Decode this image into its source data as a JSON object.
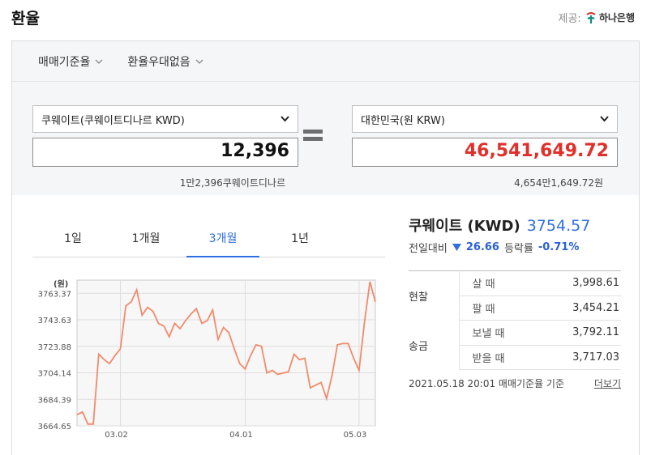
{
  "header": {
    "title": "환율",
    "provider_label": "제공:",
    "bank_name": "하나은행"
  },
  "options": [
    "매매기준율",
    "환율우대없음"
  ],
  "converter": {
    "from_currency": "쿠웨이트(쿠웨이트디나르 KWD)",
    "from_amount": "12,396",
    "from_words": "1만2,396쿠웨이트디나르",
    "to_currency": "대한민국(원 KRW)",
    "to_amount": "46,541,649.72",
    "to_words": "4,654만1,649.72원"
  },
  "tabs": [
    "1일",
    "1개월",
    "3개월",
    "1년"
  ],
  "active_tab": 2,
  "info": {
    "name": "쿠웨이트 (KWD)",
    "rate": "3754.57",
    "prev_label": "전일대비",
    "change": "26.66",
    "pct_label": "등락률",
    "pct": "-0.71%"
  },
  "rates_table": [
    {
      "category": "현찰",
      "label": "살 때",
      "value": "3,998.61"
    },
    {
      "category": "",
      "label": "팔 때",
      "value": "3,454.21"
    },
    {
      "category": "송금",
      "label": "보낼 때",
      "value": "3,792.11"
    },
    {
      "category": "",
      "label": "받을 때",
      "value": "3,717.03"
    }
  ],
  "footnote": {
    "text": "2021.05.18 20:01 매매기준율 기준",
    "more": "더보기"
  },
  "colors": {
    "accent_blue": "#2f6fe1",
    "amount_red": "#e0302b",
    "line": "#f28b6b"
  },
  "chart_data": {
    "type": "line",
    "ylabel": "(원)",
    "y_ticks": [
      "3763.37",
      "3743.63",
      "3723.88",
      "3704.14",
      "3684.39",
      "3664.65"
    ],
    "ylim": [
      3664.65,
      3773.2
    ],
    "x_ticks": [
      "03.02",
      "04.01",
      "05.03"
    ],
    "grid": true,
    "series": [
      {
        "values": [
          3673,
          3675,
          3666,
          3666,
          3718,
          3714,
          3711,
          3717,
          3722,
          3754,
          3757,
          3766,
          3747,
          3753,
          3750,
          3741,
          3739,
          3731,
          3741,
          3737,
          3743,
          3748,
          3752,
          3741,
          3743,
          3751,
          3729,
          3738,
          3734,
          3722,
          3711,
          3707,
          3717,
          3725,
          3724,
          3704,
          3706,
          3703,
          3704,
          3705,
          3718,
          3714,
          3715,
          3693,
          3695,
          3697,
          3685,
          3702,
          3725,
          3726,
          3726,
          3715,
          3706,
          3742,
          3772,
          3757
        ]
      }
    ]
  }
}
